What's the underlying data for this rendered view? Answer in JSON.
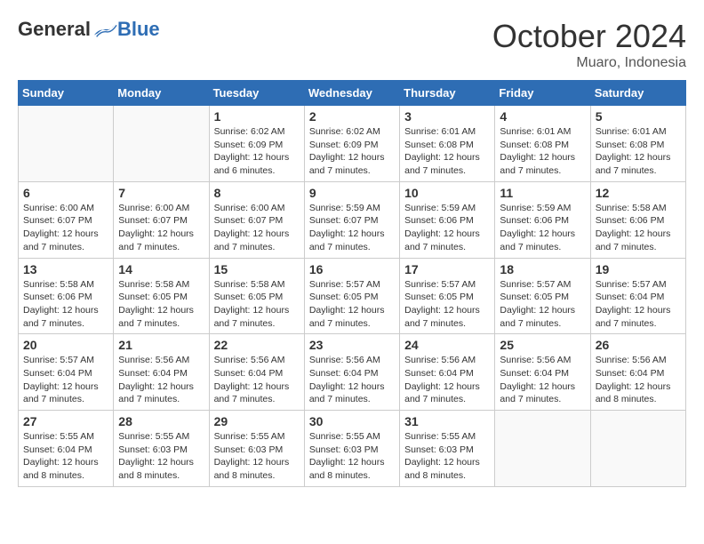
{
  "header": {
    "logo_general": "General",
    "logo_blue": "Blue",
    "month": "October 2024",
    "location": "Muaro, Indonesia"
  },
  "days_of_week": [
    "Sunday",
    "Monday",
    "Tuesday",
    "Wednesday",
    "Thursday",
    "Friday",
    "Saturday"
  ],
  "weeks": [
    [
      {
        "day": "",
        "info": ""
      },
      {
        "day": "",
        "info": ""
      },
      {
        "day": "1",
        "sunrise": "Sunrise: 6:02 AM",
        "sunset": "Sunset: 6:09 PM",
        "daylight": "Daylight: 12 hours and 6 minutes."
      },
      {
        "day": "2",
        "sunrise": "Sunrise: 6:02 AM",
        "sunset": "Sunset: 6:09 PM",
        "daylight": "Daylight: 12 hours and 7 minutes."
      },
      {
        "day": "3",
        "sunrise": "Sunrise: 6:01 AM",
        "sunset": "Sunset: 6:08 PM",
        "daylight": "Daylight: 12 hours and 7 minutes."
      },
      {
        "day": "4",
        "sunrise": "Sunrise: 6:01 AM",
        "sunset": "Sunset: 6:08 PM",
        "daylight": "Daylight: 12 hours and 7 minutes."
      },
      {
        "day": "5",
        "sunrise": "Sunrise: 6:01 AM",
        "sunset": "Sunset: 6:08 PM",
        "daylight": "Daylight: 12 hours and 7 minutes."
      }
    ],
    [
      {
        "day": "6",
        "sunrise": "Sunrise: 6:00 AM",
        "sunset": "Sunset: 6:07 PM",
        "daylight": "Daylight: 12 hours and 7 minutes."
      },
      {
        "day": "7",
        "sunrise": "Sunrise: 6:00 AM",
        "sunset": "Sunset: 6:07 PM",
        "daylight": "Daylight: 12 hours and 7 minutes."
      },
      {
        "day": "8",
        "sunrise": "Sunrise: 6:00 AM",
        "sunset": "Sunset: 6:07 PM",
        "daylight": "Daylight: 12 hours and 7 minutes."
      },
      {
        "day": "9",
        "sunrise": "Sunrise: 5:59 AM",
        "sunset": "Sunset: 6:07 PM",
        "daylight": "Daylight: 12 hours and 7 minutes."
      },
      {
        "day": "10",
        "sunrise": "Sunrise: 5:59 AM",
        "sunset": "Sunset: 6:06 PM",
        "daylight": "Daylight: 12 hours and 7 minutes."
      },
      {
        "day": "11",
        "sunrise": "Sunrise: 5:59 AM",
        "sunset": "Sunset: 6:06 PM",
        "daylight": "Daylight: 12 hours and 7 minutes."
      },
      {
        "day": "12",
        "sunrise": "Sunrise: 5:58 AM",
        "sunset": "Sunset: 6:06 PM",
        "daylight": "Daylight: 12 hours and 7 minutes."
      }
    ],
    [
      {
        "day": "13",
        "sunrise": "Sunrise: 5:58 AM",
        "sunset": "Sunset: 6:06 PM",
        "daylight": "Daylight: 12 hours and 7 minutes."
      },
      {
        "day": "14",
        "sunrise": "Sunrise: 5:58 AM",
        "sunset": "Sunset: 6:05 PM",
        "daylight": "Daylight: 12 hours and 7 minutes."
      },
      {
        "day": "15",
        "sunrise": "Sunrise: 5:58 AM",
        "sunset": "Sunset: 6:05 PM",
        "daylight": "Daylight: 12 hours and 7 minutes."
      },
      {
        "day": "16",
        "sunrise": "Sunrise: 5:57 AM",
        "sunset": "Sunset: 6:05 PM",
        "daylight": "Daylight: 12 hours and 7 minutes."
      },
      {
        "day": "17",
        "sunrise": "Sunrise: 5:57 AM",
        "sunset": "Sunset: 6:05 PM",
        "daylight": "Daylight: 12 hours and 7 minutes."
      },
      {
        "day": "18",
        "sunrise": "Sunrise: 5:57 AM",
        "sunset": "Sunset: 6:05 PM",
        "daylight": "Daylight: 12 hours and 7 minutes."
      },
      {
        "day": "19",
        "sunrise": "Sunrise: 5:57 AM",
        "sunset": "Sunset: 6:04 PM",
        "daylight": "Daylight: 12 hours and 7 minutes."
      }
    ],
    [
      {
        "day": "20",
        "sunrise": "Sunrise: 5:57 AM",
        "sunset": "Sunset: 6:04 PM",
        "daylight": "Daylight: 12 hours and 7 minutes."
      },
      {
        "day": "21",
        "sunrise": "Sunrise: 5:56 AM",
        "sunset": "Sunset: 6:04 PM",
        "daylight": "Daylight: 12 hours and 7 minutes."
      },
      {
        "day": "22",
        "sunrise": "Sunrise: 5:56 AM",
        "sunset": "Sunset: 6:04 PM",
        "daylight": "Daylight: 12 hours and 7 minutes."
      },
      {
        "day": "23",
        "sunrise": "Sunrise: 5:56 AM",
        "sunset": "Sunset: 6:04 PM",
        "daylight": "Daylight: 12 hours and 7 minutes."
      },
      {
        "day": "24",
        "sunrise": "Sunrise: 5:56 AM",
        "sunset": "Sunset: 6:04 PM",
        "daylight": "Daylight: 12 hours and 7 minutes."
      },
      {
        "day": "25",
        "sunrise": "Sunrise: 5:56 AM",
        "sunset": "Sunset: 6:04 PM",
        "daylight": "Daylight: 12 hours and 7 minutes."
      },
      {
        "day": "26",
        "sunrise": "Sunrise: 5:56 AM",
        "sunset": "Sunset: 6:04 PM",
        "daylight": "Daylight: 12 hours and 8 minutes."
      }
    ],
    [
      {
        "day": "27",
        "sunrise": "Sunrise: 5:55 AM",
        "sunset": "Sunset: 6:04 PM",
        "daylight": "Daylight: 12 hours and 8 minutes."
      },
      {
        "day": "28",
        "sunrise": "Sunrise: 5:55 AM",
        "sunset": "Sunset: 6:03 PM",
        "daylight": "Daylight: 12 hours and 8 minutes."
      },
      {
        "day": "29",
        "sunrise": "Sunrise: 5:55 AM",
        "sunset": "Sunset: 6:03 PM",
        "daylight": "Daylight: 12 hours and 8 minutes."
      },
      {
        "day": "30",
        "sunrise": "Sunrise: 5:55 AM",
        "sunset": "Sunset: 6:03 PM",
        "daylight": "Daylight: 12 hours and 8 minutes."
      },
      {
        "day": "31",
        "sunrise": "Sunrise: 5:55 AM",
        "sunset": "Sunset: 6:03 PM",
        "daylight": "Daylight: 12 hours and 8 minutes."
      },
      {
        "day": "",
        "info": ""
      },
      {
        "day": "",
        "info": ""
      }
    ]
  ]
}
